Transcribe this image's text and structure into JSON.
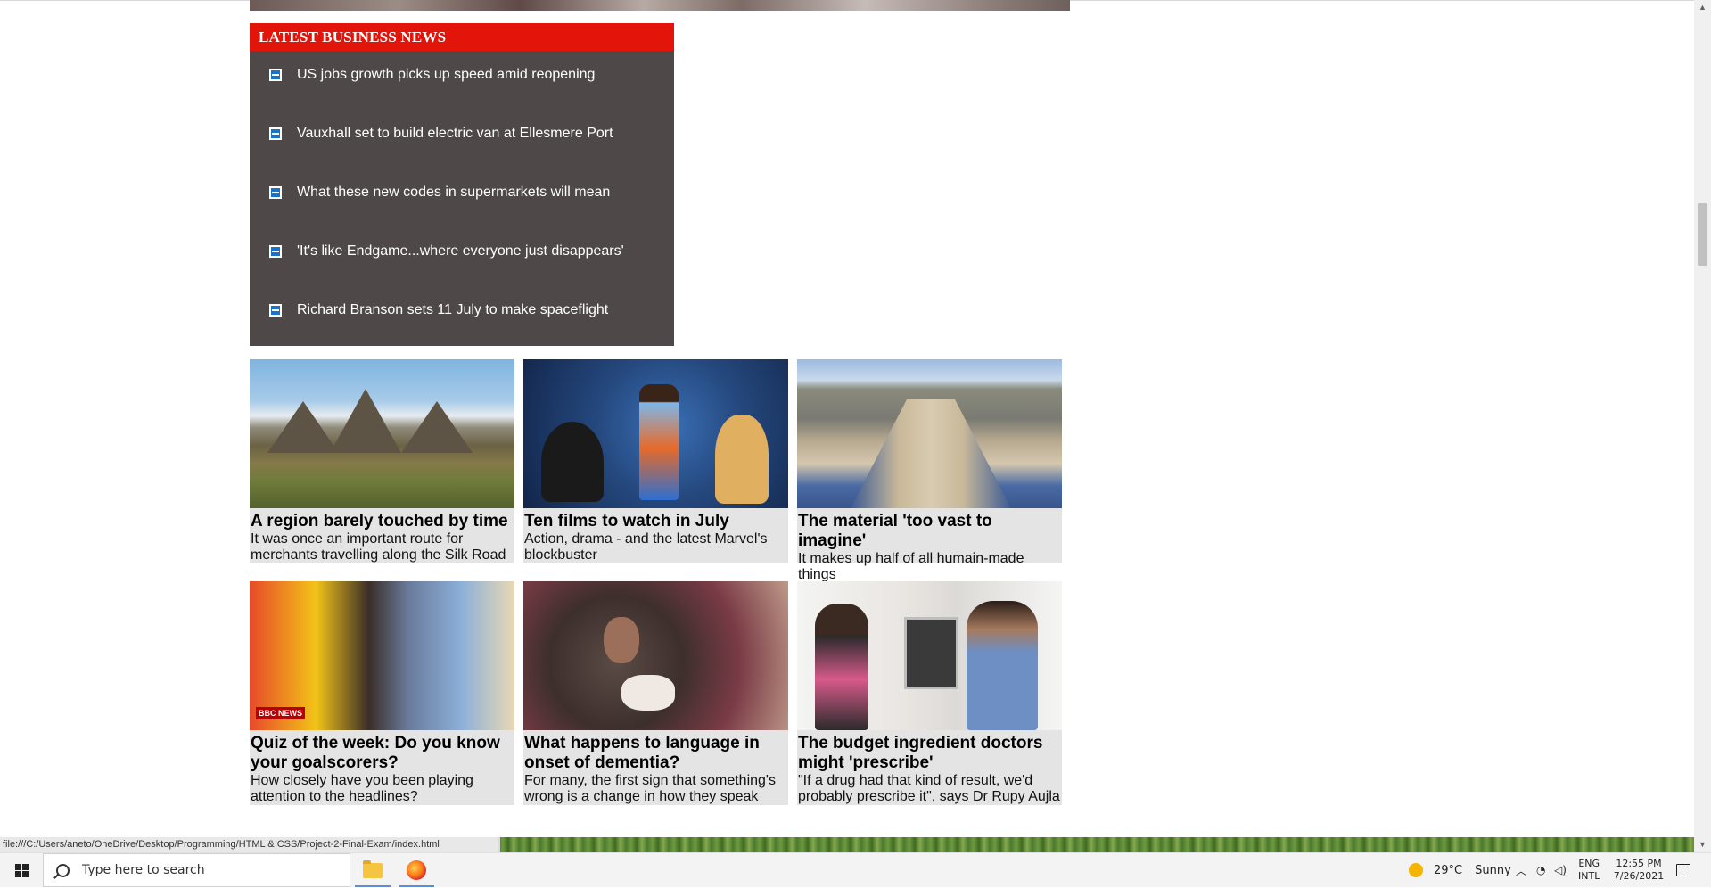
{
  "news": {
    "header": "LATEST BUSINESS NEWS",
    "items": [
      {
        "label": "US jobs growth picks up speed amid reopening"
      },
      {
        "label": "Vauxhall set to build electric van at Ellesmere Port"
      },
      {
        "label": "What these new codes in supermarkets will mean"
      },
      {
        "label": "'It's like Endgame...where everyone just disappears'"
      },
      {
        "label": "Richard Branson sets 11 July to make spaceflight"
      }
    ]
  },
  "cards": [
    {
      "title": "A region barely touched by time",
      "desc": "It was once an important route for merchants travelling along the Silk Road"
    },
    {
      "title": "Ten films to watch in July",
      "desc": "Action, drama - and the latest Marvel's blockbuster"
    },
    {
      "title": "The material 'too vast to imagine'",
      "desc": "It makes up half of all humain-made things"
    },
    {
      "title": "Quiz of the week: Do you know your goalscorers?",
      "desc": "How closely have you been playing attention to the headlines?",
      "badge": "BBC NEWS"
    },
    {
      "title": "What happens to language in onset of dementia?",
      "desc": "For many, the first sign that something's wrong is a change in how they speak"
    },
    {
      "title": "The budget ingredient doctors might 'prescribe'",
      "desc": "\"If a drug had that kind of result, we'd probably prescribe it\", says Dr Rupy Aujla"
    }
  ],
  "status_url": "file:///C:/Users/aneto/OneDrive/Desktop/Programming/HTML & CSS/Project-2-Final-Exam/index.html",
  "taskbar": {
    "search_placeholder": "Type here to search",
    "weather_temp": "29°C",
    "weather_text": "Sunny",
    "lang_top": "ENG",
    "lang_bottom": "INTL",
    "time": "12:55 PM",
    "date": "7/26/2021"
  },
  "colors": {
    "news_header": "#e3140a",
    "news_bg": "#4e4948",
    "card_bg": "#e4e4e4"
  }
}
